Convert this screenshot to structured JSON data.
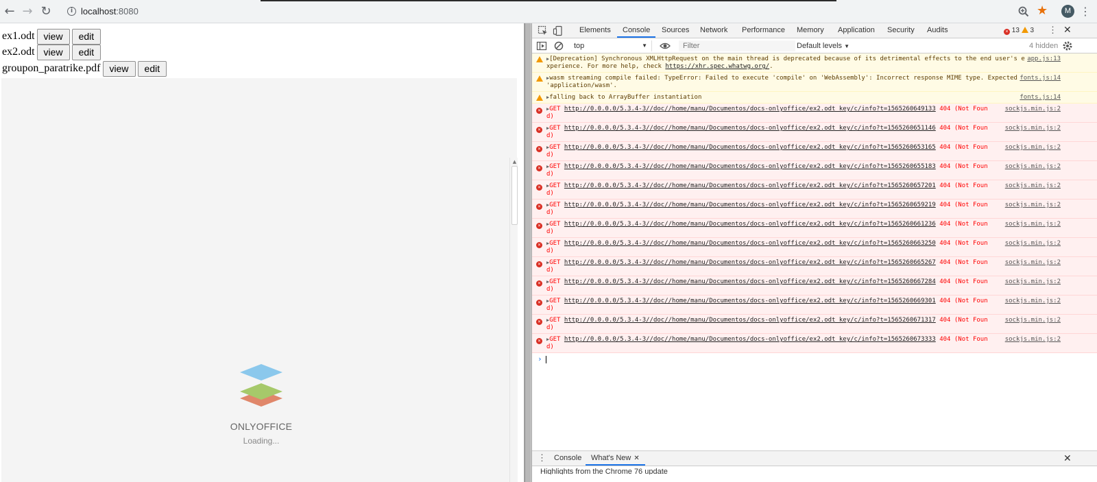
{
  "browser": {
    "url_host": "localhost",
    "url_port": ":8080",
    "avatar_letter": "M"
  },
  "page": {
    "files": [
      {
        "name": "ex1.odt",
        "view_label": "view",
        "edit_label": "edit"
      },
      {
        "name": "ex2.odt",
        "view_label": "view",
        "edit_label": "edit"
      },
      {
        "name": "groupon_paratrike.pdf",
        "view_label": "view",
        "edit_label": "edit"
      }
    ],
    "editor": {
      "brand": "ONLYOFFICE",
      "loading": "Loading...",
      "logo_colors": {
        "top": "#8bc8ec",
        "middle": "#a6c96a",
        "bottom": "#e0876a"
      }
    }
  },
  "devtools": {
    "tabs": [
      "Elements",
      "Console",
      "Sources",
      "Network",
      "Performance",
      "Memory",
      "Application",
      "Security",
      "Audits"
    ],
    "active_tab": "Console",
    "error_count": "13",
    "warning_count": "3",
    "context": "top",
    "filter_placeholder": "Filter",
    "levels": "Default levels",
    "hidden": "4 hidden",
    "messages": [
      {
        "level": "warn",
        "text_prefix": "[Deprecation] Synchronous XMLHttpRequest on the main thread is deprecated because of its detrimental effects to the end user's experience. For more help, check ",
        "link": "https://xhr.spec.whatwg.org/",
        "text_suffix": ".",
        "source": "app.js:13"
      },
      {
        "level": "warn",
        "text_prefix": "wasm streaming compile failed: TypeError: Failed to execute 'compile' on 'WebAssembly': Incorrect response MIME type. Expected 'application/wasm'.",
        "link": "",
        "text_suffix": "",
        "source": "fonts.js:14"
      },
      {
        "level": "warn",
        "text_prefix": "falling back to ArrayBuffer instantiation",
        "link": "",
        "text_suffix": "",
        "source": "fonts.js:14"
      },
      {
        "level": "error",
        "method": "GET",
        "url": "http://0.0.0.0/5.3.4-3//doc//home/manu/Documentos/docs-onlyoffice/ex2.odt_key/c/info?t=1565260649133",
        "status": "404 (Not Found)",
        "source": "sockjs.min.js:2"
      },
      {
        "level": "error",
        "method": "GET",
        "url": "http://0.0.0.0/5.3.4-3//doc//home/manu/Documentos/docs-onlyoffice/ex2.odt_key/c/info?t=1565260651146",
        "status": "404 (Not Found)",
        "source": "sockjs.min.js:2"
      },
      {
        "level": "error",
        "method": "GET",
        "url": "http://0.0.0.0/5.3.4-3//doc//home/manu/Documentos/docs-onlyoffice/ex2.odt_key/c/info?t=1565260653165",
        "status": "404 (Not Found)",
        "source": "sockjs.min.js:2"
      },
      {
        "level": "error",
        "method": "GET",
        "url": "http://0.0.0.0/5.3.4-3//doc//home/manu/Documentos/docs-onlyoffice/ex2.odt_key/c/info?t=1565260655183",
        "status": "404 (Not Found)",
        "source": "sockjs.min.js:2"
      },
      {
        "level": "error",
        "method": "GET",
        "url": "http://0.0.0.0/5.3.4-3//doc//home/manu/Documentos/docs-onlyoffice/ex2.odt_key/c/info?t=1565260657201",
        "status": "404 (Not Found)",
        "source": "sockjs.min.js:2"
      },
      {
        "level": "error",
        "method": "GET",
        "url": "http://0.0.0.0/5.3.4-3//doc//home/manu/Documentos/docs-onlyoffice/ex2.odt_key/c/info?t=1565260659219",
        "status": "404 (Not Found)",
        "source": "sockjs.min.js:2"
      },
      {
        "level": "error",
        "method": "GET",
        "url": "http://0.0.0.0/5.3.4-3//doc//home/manu/Documentos/docs-onlyoffice/ex2.odt_key/c/info?t=1565260661236",
        "status": "404 (Not Found)",
        "source": "sockjs.min.js:2"
      },
      {
        "level": "error",
        "method": "GET",
        "url": "http://0.0.0.0/5.3.4-3//doc//home/manu/Documentos/docs-onlyoffice/ex2.odt_key/c/info?t=1565260663250",
        "status": "404 (Not Found)",
        "source": "sockjs.min.js:2"
      },
      {
        "level": "error",
        "method": "GET",
        "url": "http://0.0.0.0/5.3.4-3//doc//home/manu/Documentos/docs-onlyoffice/ex2.odt_key/c/info?t=1565260665267",
        "status": "404 (Not Found)",
        "source": "sockjs.min.js:2"
      },
      {
        "level": "error",
        "method": "GET",
        "url": "http://0.0.0.0/5.3.4-3//doc//home/manu/Documentos/docs-onlyoffice/ex2.odt_key/c/info?t=1565260667284",
        "status": "404 (Not Found)",
        "source": "sockjs.min.js:2"
      },
      {
        "level": "error",
        "method": "GET",
        "url": "http://0.0.0.0/5.3.4-3//doc//home/manu/Documentos/docs-onlyoffice/ex2.odt_key/c/info?t=1565260669301",
        "status": "404 (Not Found)",
        "source": "sockjs.min.js:2"
      },
      {
        "level": "error",
        "method": "GET",
        "url": "http://0.0.0.0/5.3.4-3//doc//home/manu/Documentos/docs-onlyoffice/ex2.odt_key/c/info?t=1565260671317",
        "status": "404 (Not Found)",
        "source": "sockjs.min.js:2"
      },
      {
        "level": "error",
        "method": "GET",
        "url": "http://0.0.0.0/5.3.4-3//doc//home/manu/Documentos/docs-onlyoffice/ex2.odt_key/c/info?t=1565260673333",
        "status": "404 (Not Found)",
        "source": "sockjs.min.js:2"
      }
    ],
    "drawer": {
      "tabs": [
        "Console",
        "What's New"
      ],
      "active_tab": "What's New",
      "body_text": "Highlights from the Chrome 76 update"
    }
  },
  "colors": {
    "accent": "#1a73e8",
    "error": "#d93025",
    "warning": "#f29900",
    "star": "#e8710a"
  }
}
